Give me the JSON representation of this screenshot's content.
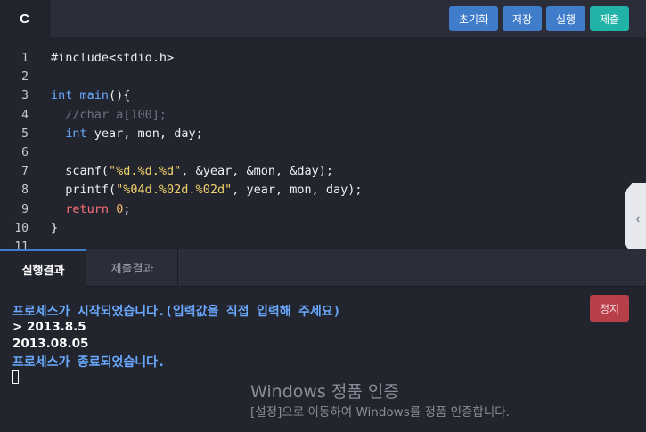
{
  "editor": {
    "language_tab": "C",
    "buttons": {
      "reset": "초기화",
      "save": "저장",
      "run": "실행",
      "submit": "제출"
    },
    "line_numbers": [
      "1",
      "2",
      "3",
      "4",
      "5",
      "6",
      "7",
      "8",
      "9",
      "10",
      "11"
    ],
    "code_lines": [
      "#include<stdio.h>",
      "",
      "int main(){",
      "  //char a[100];",
      "  int year, mon, day;",
      "",
      "  scanf(\"%d.%d.%d\", &year, &mon, &day);",
      "  printf(\"%04d.%02d.%02d\", year, mon, day);",
      "  return 0;",
      "}",
      ""
    ],
    "side_panel_toggle": "‹"
  },
  "results": {
    "tabs": {
      "output": "실행결과",
      "submission": "제출결과"
    },
    "stop_button": "정지",
    "console_lines": [
      "프로세스가 시작되었습니다.(입력값을 직접 입력해 주세요)",
      "> 2013.8.5",
      "2013.08.05",
      "프로세스가 종료되었습니다."
    ]
  },
  "watermark": {
    "title": "Windows 정품 인증",
    "subtitle": "[설정]으로 이동하여 Windows를 정품 인증합니다."
  },
  "colors": {
    "background": "#23252e",
    "keyword": "#69a9ff",
    "string": "#f2d36b",
    "return_keyword": "#ff6f7a",
    "comment": "#6e7280",
    "primary_button": "#3f7dcb",
    "submit_button": "#21b3a7",
    "stop_button": "#b8404a"
  },
  "icons": {
    "side_panel_toggle": "chevron-left-icon"
  }
}
